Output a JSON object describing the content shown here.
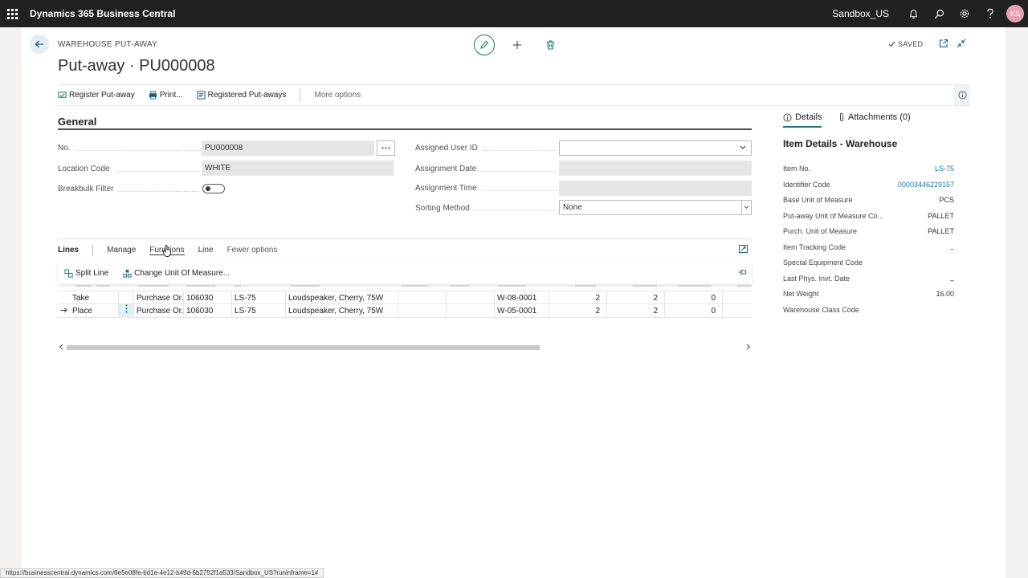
{
  "app": {
    "title": "Dynamics 365 Business Central",
    "environment": "Sandbox_US",
    "user_initials": "KS"
  },
  "header": {
    "caption": "WAREHOUSE PUT-AWAY",
    "title": "Put-away · PU000008",
    "saved_label": "SAVED"
  },
  "actions": {
    "register": "Register Put-away",
    "print": "Print...",
    "registered": "Registered Put-aways",
    "more": "More options"
  },
  "general": {
    "title": "General",
    "fields": {
      "no_label": "No.",
      "no_value": "PU000008",
      "location_label": "Location Code",
      "location_value": "WHITE",
      "breakbulk_label": "Breakbulk Filter",
      "breakbulk_on": false,
      "assigned_user_label": "Assigned User ID",
      "assigned_user_value": "",
      "assignment_date_label": "Assignment Date",
      "assignment_date_value": "",
      "assignment_time_label": "Assignment Time",
      "assignment_time_value": "",
      "sorting_label": "Sorting Method",
      "sorting_value": "None"
    }
  },
  "lines": {
    "title": "Lines",
    "tabs": [
      "Manage",
      "Functions",
      "Line",
      "Fewer options"
    ],
    "active_tab": "Functions",
    "sub_actions": {
      "split": "Split Line",
      "change_uom": "Change Unit Of Measure..."
    },
    "rows": [
      {
        "action": "Take",
        "source_doc": "Purchase Or...",
        "source_no": "106030",
        "item_no": "LS-75",
        "description": "Loudspeaker, Cherry, 75W",
        "bin": "W-08-0001",
        "q1": "2",
        "q2": "2",
        "q3": "0",
        "current": false
      },
      {
        "action": "Place",
        "source_doc": "Purchase Or...",
        "source_no": "106030",
        "item_no": "LS-75",
        "description": "Loudspeaker, Cherry, 75W",
        "bin": "W-05-0001",
        "q1": "2",
        "q2": "2",
        "q3": "0",
        "current": true
      }
    ]
  },
  "factbox": {
    "tab_details": "Details",
    "tab_attachments": "Attachments (0)",
    "title": "Item Details - Warehouse",
    "facts": [
      {
        "label": "Item No.",
        "value": "LS-75",
        "link": true
      },
      {
        "label": "Identifier Code",
        "value": "00003446229157",
        "link": true
      },
      {
        "label": "Base Unit of Measure",
        "value": "PCS",
        "link": false
      },
      {
        "label": "Put-away Unit of Measure Co...",
        "value": "PALLET",
        "link": false
      },
      {
        "label": "Purch. Unit of Measure",
        "value": "PALLET",
        "link": false
      },
      {
        "label": "Item Tracking Code",
        "value": "_",
        "link": false
      },
      {
        "label": "Special Equipment Code",
        "value": "",
        "link": false
      },
      {
        "label": "Last Phys. Invt. Date",
        "value": "_",
        "link": false
      },
      {
        "label": "Net Weight",
        "value": "16.00",
        "link": false
      },
      {
        "label": "Warehouse Class Code",
        "value": "",
        "link": false
      }
    ]
  },
  "status_url": "https://businesscentral.dynamics.com/8e5e08fe-bd1e-4e12-b49d-6b2752f1a533/Sandbox_US?runinframe=1#",
  "colors": {
    "topbar": "#212121",
    "accent": "#1a7a6e",
    "link": "#1a7a9a",
    "avatar": "#e8a0b4"
  }
}
